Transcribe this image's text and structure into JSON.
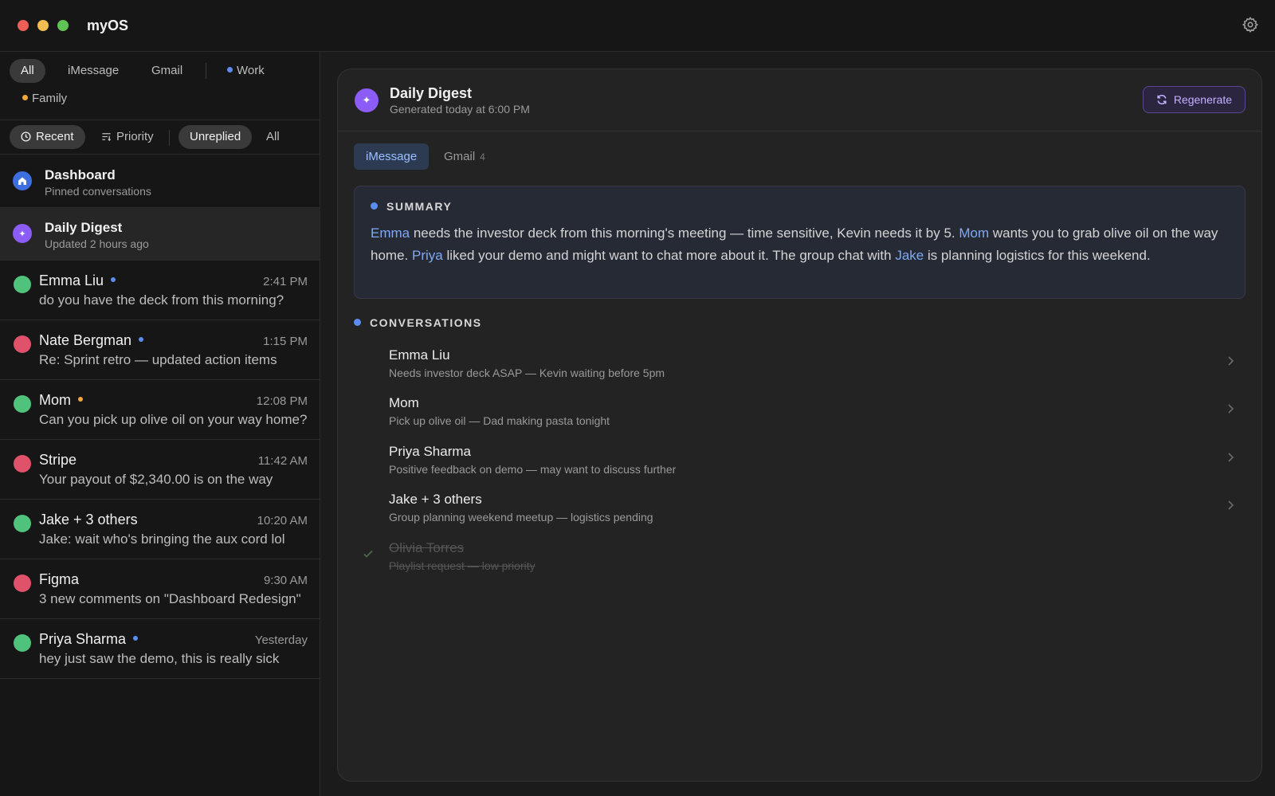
{
  "window": {
    "title": "myOS"
  },
  "filters": {
    "sources": [
      {
        "label": "All",
        "active": true
      },
      {
        "label": "iMessage",
        "active": false
      },
      {
        "label": "Gmail",
        "active": false
      }
    ],
    "groups": [
      {
        "label": "Work",
        "color": "#5b8def"
      },
      {
        "label": "Family",
        "color": "#f0a83c"
      }
    ],
    "sort": [
      {
        "label": "Recent",
        "icon": "clock-icon",
        "active": true
      },
      {
        "label": "Priority",
        "icon": "sort-icon",
        "active": false
      }
    ],
    "status": [
      {
        "label": "Unreplied",
        "active": true
      },
      {
        "label": "All",
        "active": false
      }
    ]
  },
  "pinned": [
    {
      "title": "Dashboard",
      "subtitle": "Pinned conversations",
      "icon": "home-icon",
      "color": "#3d6fe0"
    },
    {
      "title": "Daily Digest",
      "subtitle": "Updated 2 hours ago",
      "icon": "sparkle-icon",
      "color": "#8b5cf6"
    }
  ],
  "conversations": [
    {
      "name": "Emma Liu",
      "time": "2:41 PM",
      "preview": "do you have the deck from this morning?",
      "avatar": "#4fc27c",
      "unread": "#5b8def"
    },
    {
      "name": "Nate Bergman",
      "time": "1:15 PM",
      "preview": "Re: Sprint retro — updated action items",
      "avatar": "#e0526a",
      "unread": "#5b8def"
    },
    {
      "name": "Mom",
      "time": "12:08 PM",
      "preview": "Can you pick up olive oil on your way home?",
      "avatar": "#4fc27c",
      "unread": "#f0a83c"
    },
    {
      "name": "Stripe",
      "time": "11:42 AM",
      "preview": "Your payout of $2,340.00 is on the way",
      "avatar": "#e0526a",
      "unread": ""
    },
    {
      "name": "Jake + 3 others",
      "time": "10:20 AM",
      "preview": "Jake: wait who's bringing the aux cord lol",
      "avatar": "#4fc27c",
      "unread": ""
    },
    {
      "name": "Figma",
      "time": "9:30 AM",
      "preview": "3 new comments on \"Dashboard Redesign\"",
      "avatar": "#e0526a",
      "unread": ""
    },
    {
      "name": "Priya Sharma",
      "time": "Yesterday",
      "preview": "hey just saw the demo, this is really sick",
      "avatar": "#4fc27c",
      "unread": "#5b8def"
    }
  ],
  "digest": {
    "title": "Daily Digest",
    "subtitle": "Generated today at 6:00 PM",
    "regenerate_label": "Regenerate",
    "tabs": [
      {
        "label": "iMessage",
        "count": "",
        "active": true
      },
      {
        "label": "Gmail",
        "count": "4",
        "active": false
      }
    ],
    "summary_heading": "SUMMARY",
    "summary_parts": [
      {
        "text": "Emma",
        "hl": true
      },
      {
        "text": " needs the investor deck from this morning's meeting — time sensitive, Kevin needs it by 5. ",
        "hl": false
      },
      {
        "text": "Mom",
        "hl": true
      },
      {
        "text": " wants you to grab olive oil on the way home. ",
        "hl": false
      },
      {
        "text": "Priya",
        "hl": true
      },
      {
        "text": " liked your demo and might want to chat more about it. The group chat with ",
        "hl": false
      },
      {
        "text": "Jake",
        "hl": true
      },
      {
        "text": " is planning logistics for this weekend.",
        "hl": false
      }
    ],
    "conversations_heading": "CONVERSATIONS",
    "items": [
      {
        "name": "Emma Liu",
        "desc": "Needs investor deck ASAP — Kevin waiting before 5pm",
        "done": false
      },
      {
        "name": "Mom",
        "desc": "Pick up olive oil — Dad making pasta tonight",
        "done": false
      },
      {
        "name": "Priya Sharma",
        "desc": "Positive feedback on demo — may want to discuss further",
        "done": false
      },
      {
        "name": "Jake + 3 others",
        "desc": "Group planning weekend meetup — logistics pending",
        "done": false
      },
      {
        "name": "Olivia Torres",
        "desc": "Playlist request — low priority",
        "done": true
      }
    ]
  }
}
